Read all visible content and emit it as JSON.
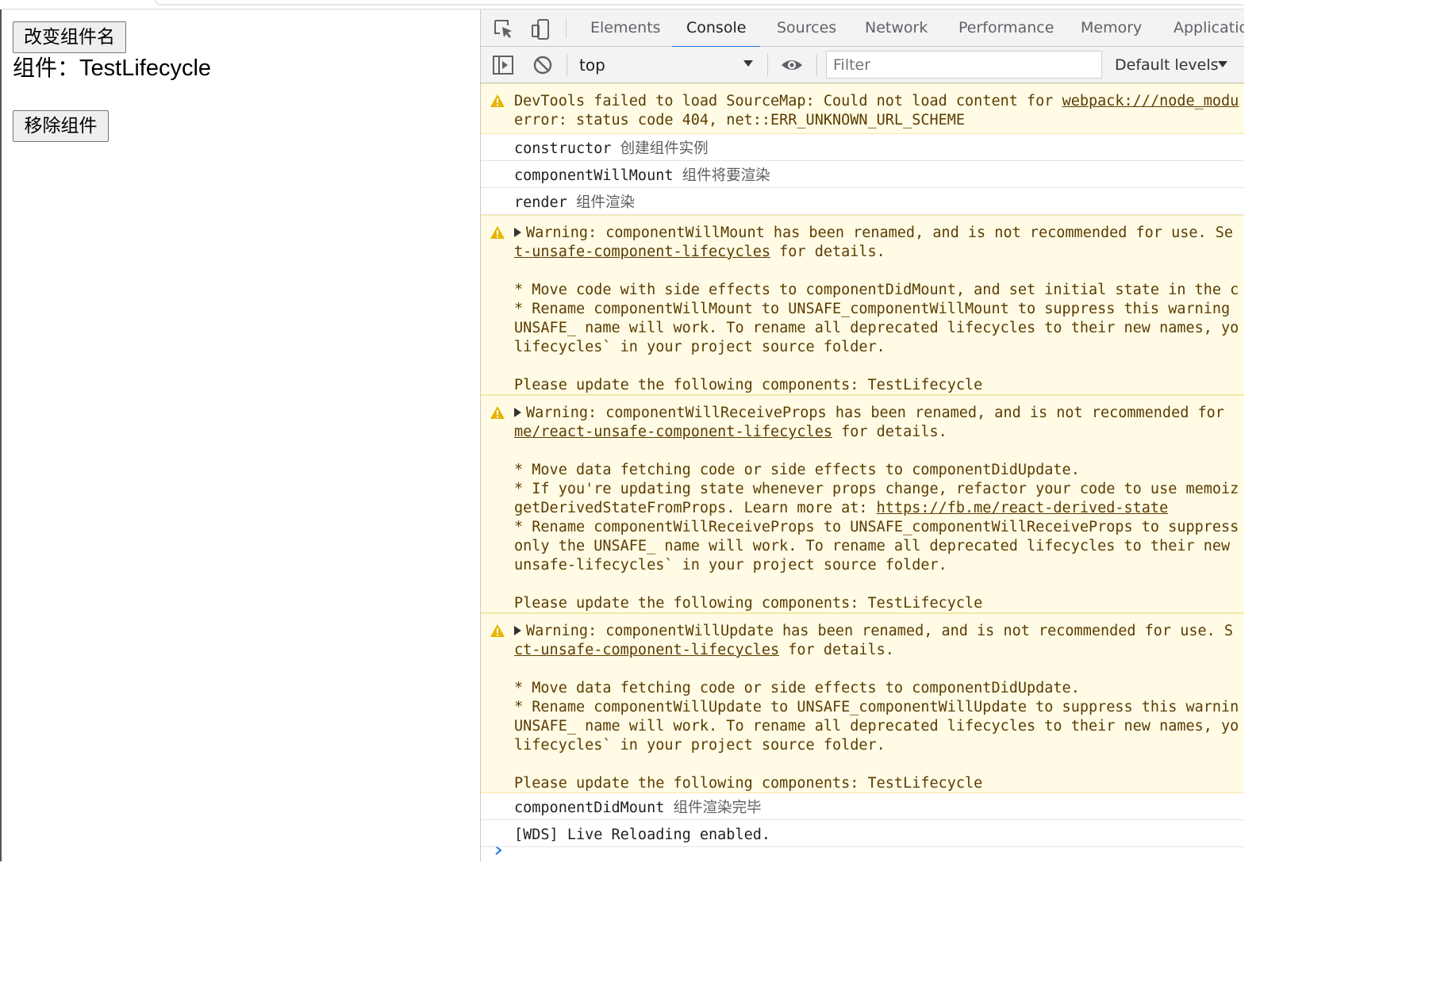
{
  "page": {
    "rename_button": "改变组件名",
    "component_label_prefix": "组件：",
    "component_name": "TestLifecycle",
    "remove_button": "移除组件"
  },
  "devtools": {
    "tabs": [
      "Elements",
      "Console",
      "Sources",
      "Network",
      "Performance",
      "Memory",
      "Applicatio"
    ],
    "active_tab": "Console",
    "context": "top",
    "filter_placeholder": "Filter",
    "levels": "Default levels",
    "accent_color": "#1a73e8",
    "warning_bg": "#fffbe5",
    "icons": [
      "inspect-element-icon",
      "device-toolbar-icon",
      "sidebar-toggle-icon",
      "clear-console-icon",
      "eye-icon",
      "warning-icon",
      "prompt-chevron-icon"
    ],
    "messages": [
      {
        "type": "warning",
        "lines": [
          {
            "text": "DevTools failed to load SourceMap: Could not load content for ",
            "link": "webpack:///node_modu"
          },
          {
            "text": "error: status code 404, net::ERR_UNKNOWN_URL_SCHEME"
          }
        ]
      },
      {
        "type": "log",
        "code": "constructor",
        "note": "创建组件实例"
      },
      {
        "type": "log",
        "code": "componentWillMount",
        "note": "组件将要渲染"
      },
      {
        "type": "log",
        "code": "render",
        "note": "组件渲染"
      },
      {
        "type": "warning",
        "lines": [
          {
            "text": "Warning: componentWillMount has been renamed, and is not recommended for use. Se",
            "expander": true
          },
          {
            "link": "t-unsafe-component-lifecycles",
            "text": " for details."
          },
          {
            "text": ""
          },
          {
            "text": "* Move code with side effects to componentDidMount, and set initial state in the c"
          },
          {
            "text": "* Rename componentWillMount to UNSAFE_componentWillMount to suppress this warning"
          },
          {
            "text": "UNSAFE_ name will work. To rename all deprecated lifecycles to their new names, yo"
          },
          {
            "text": "lifecycles` in your project source folder."
          },
          {
            "text": ""
          },
          {
            "text": "Please update the following components: TestLifecycle"
          }
        ]
      },
      {
        "type": "warning",
        "lines": [
          {
            "text": "Warning: componentWillReceiveProps has been renamed, and is not recommended for",
            "expander": true
          },
          {
            "link": "me/react-unsafe-component-lifecycles",
            "text": " for details."
          },
          {
            "text": ""
          },
          {
            "text": "* Move data fetching code or side effects to componentDidUpdate."
          },
          {
            "text": "* If you're updating state whenever props change, refactor your code to use memoiz"
          },
          {
            "text": "getDerivedStateFromProps. Learn more at: ",
            "link": "https://fb.me/react-derived-state"
          },
          {
            "text": "* Rename componentWillReceiveProps to UNSAFE_componentWillReceiveProps to suppress"
          },
          {
            "text": "only the UNSAFE_ name will work. To rename all deprecated lifecycles to their new"
          },
          {
            "text": "unsafe-lifecycles` in your project source folder."
          },
          {
            "text": ""
          },
          {
            "text": "Please update the following components: TestLifecycle"
          }
        ]
      },
      {
        "type": "warning",
        "lines": [
          {
            "text": "Warning: componentWillUpdate has been renamed, and is not recommended for use. S",
            "expander": true
          },
          {
            "link": "ct-unsafe-component-lifecycles",
            "text": " for details."
          },
          {
            "text": ""
          },
          {
            "text": "* Move data fetching code or side effects to componentDidUpdate."
          },
          {
            "text": "* Rename componentWillUpdate to UNSAFE_componentWillUpdate to suppress this warnin"
          },
          {
            "text": "UNSAFE_ name will work. To rename all deprecated lifecycles to their new names, yo"
          },
          {
            "text": "lifecycles` in your project source folder."
          },
          {
            "text": ""
          },
          {
            "text": "Please update the following components: TestLifecycle"
          }
        ]
      },
      {
        "type": "log",
        "code": "componentDidMount",
        "note": "组件渲染完毕"
      },
      {
        "type": "log",
        "code": "[WDS] Live Reloading enabled."
      }
    ]
  }
}
